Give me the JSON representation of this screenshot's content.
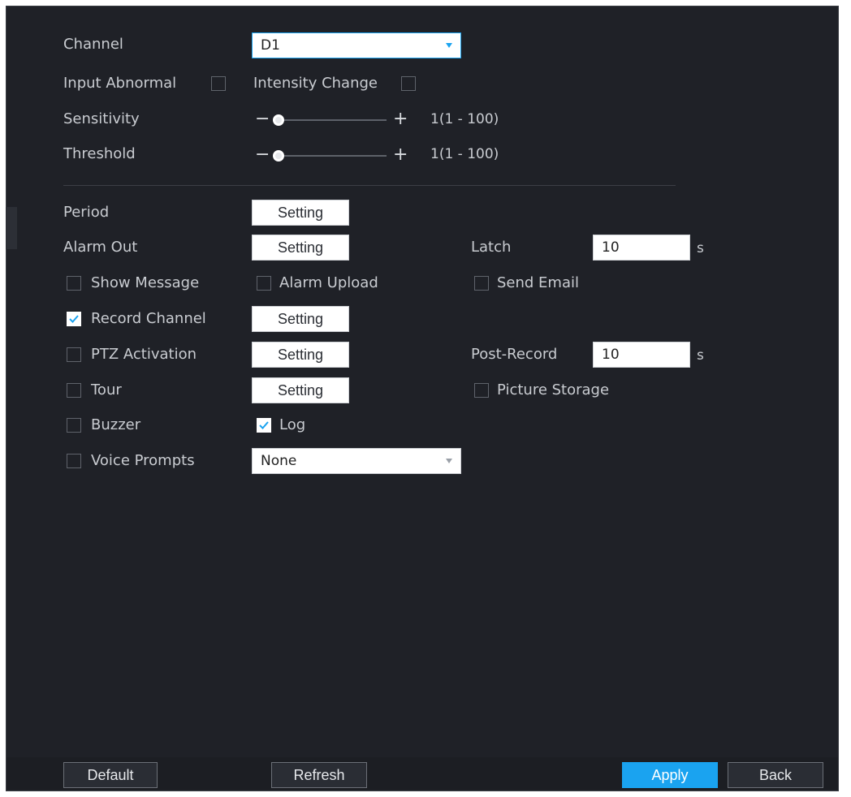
{
  "detection": {
    "channel_label": "Channel",
    "channel_value": "D1",
    "input_abnormal_label": "Input Abnormal",
    "input_abnormal_checked": false,
    "intensity_change_label": "Intensity Change",
    "intensity_change_checked": false,
    "sensitivity_label": "Sensitivity",
    "sensitivity_value": "1(1 - 100)",
    "sensitivity_level": 1,
    "threshold_label": "Threshold",
    "threshold_value": "1(1 - 100)",
    "threshold_level": 1,
    "minus_symbol": "−",
    "plus_symbol": "+"
  },
  "actions": {
    "period_label": "Period",
    "setting_label": "Setting",
    "alarm_out_label": "Alarm Out",
    "latch_label": "Latch",
    "latch_value": "10",
    "latch_unit": "s",
    "show_message_label": "Show Message",
    "show_message_checked": false,
    "alarm_upload_label": "Alarm Upload",
    "alarm_upload_checked": false,
    "send_email_label": "Send Email",
    "send_email_checked": false,
    "record_channel_label": "Record Channel",
    "record_channel_checked": true,
    "ptz_activation_label": "PTZ Activation",
    "ptz_activation_checked": false,
    "post_record_label": "Post-Record",
    "post_record_value": "10",
    "post_record_unit": "s",
    "tour_label": "Tour",
    "tour_checked": false,
    "picture_storage_label": "Picture Storage",
    "picture_storage_checked": false,
    "buzzer_label": "Buzzer",
    "buzzer_checked": false,
    "log_label": "Log",
    "log_checked": true,
    "voice_prompts_label": "Voice Prompts",
    "voice_prompts_checked": false,
    "voice_prompts_value": "None"
  },
  "footer": {
    "default_label": "Default",
    "refresh_label": "Refresh",
    "apply_label": "Apply",
    "back_label": "Back"
  },
  "colors": {
    "panel_bg": "#1f2127",
    "accent": "#1aa3f0",
    "text": "#c9ccd1"
  }
}
